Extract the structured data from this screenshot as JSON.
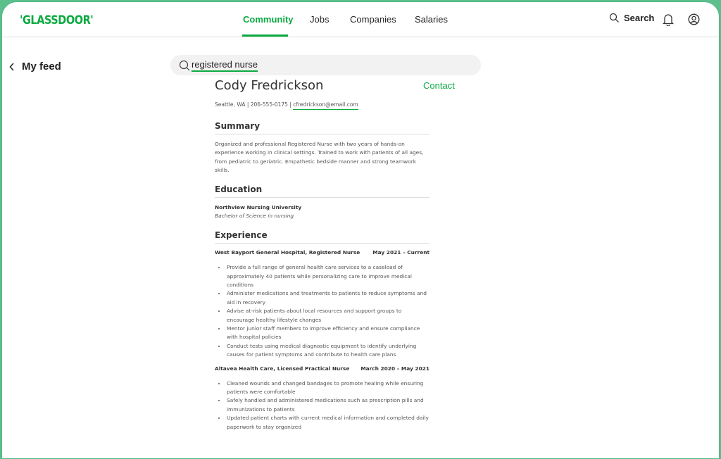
{
  "header": {
    "logo": "'GLASSDOOR'",
    "nav": [
      {
        "label": "Community",
        "active": true
      },
      {
        "label": "Jobs"
      },
      {
        "label": "Companies"
      },
      {
        "label": "Salaries"
      }
    ],
    "search_label": "Search",
    "icons": [
      "search-icon",
      "bell-icon",
      "user-icon"
    ]
  },
  "accent": "#0caa41",
  "back": {
    "label": "My feed"
  },
  "search": {
    "value": "registered nurse"
  },
  "resume": {
    "name": "Cody Fredrickson",
    "contact_label": "Contact",
    "info": "Seattle, WA | 206-555-0175 | ",
    "email": "cfredrickson@email.com",
    "summary_title": "Summary",
    "summary": "Organized and professional Registered Nurse with two years of hands-on experience working in clinical settings. Trained to work with patients of all ages, from pediatric to geriatric. Empathetic bedside manner and strong teamwork skills.",
    "education_title": "Education",
    "school": "Northview Nursing University",
    "degree": "Bachelor of Science in nursing",
    "experience_title": "Experience",
    "jobs": [
      {
        "title": "West Bayport General Hospital, Registered Nurse",
        "dates": "May 2021 – Current",
        "bullets": [
          "Provide a full range of general health care services to a caseload of approximately 40 patients while personalizing care to improve medical conditions",
          "Administer medications and treatments to patients to reduce symptoms and aid in recovery",
          "Advise at-risk patients about local resources and support groups to encourage healthy lifestyle changes",
          "Mentor junior staff members to improve efficiency and ensure compliance with hospital policies",
          "Conduct tests using medical diagnostic equipment to identify underlying causes for patient symptoms and contribute to health care plans"
        ]
      },
      {
        "title": "Altavea Health Care, Licensed Practical Nurse",
        "dates": "March 2020 – May 2021",
        "bullets": [
          "Cleaned wounds and changed bandages to promote healing while ensuring patients were comfortable",
          "Safely handled and administered medications such as prescription pills and immunizations to patients",
          "Updated patient charts with current medical information and completed daily paperwork to stay organized"
        ]
      }
    ]
  }
}
